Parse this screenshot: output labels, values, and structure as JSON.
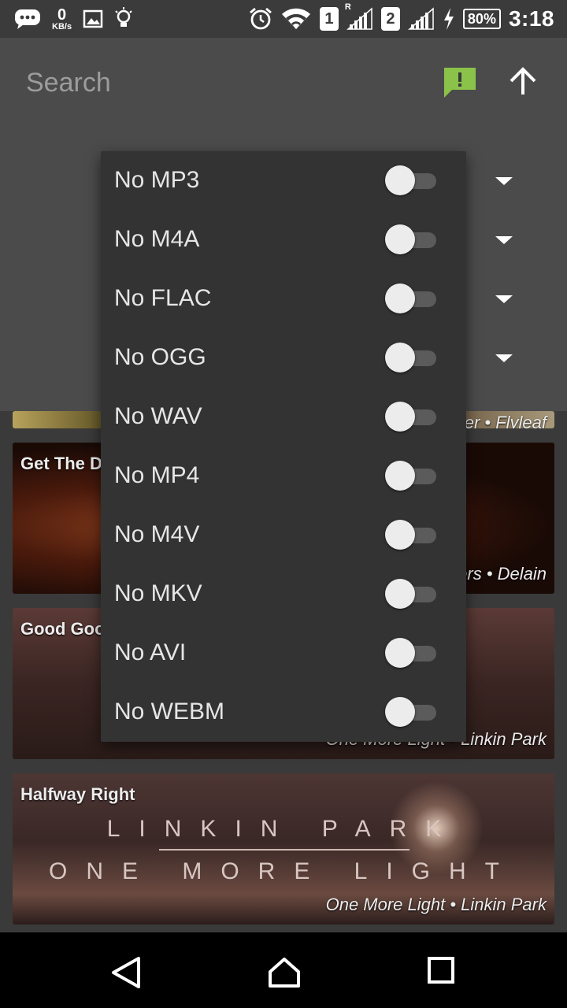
{
  "status_bar": {
    "net_speed_value": "0",
    "net_speed_unit": "KB/s",
    "sim1": "1",
    "sim1_roaming": "R",
    "sim2": "2",
    "battery": "80%",
    "time": "3:18"
  },
  "header": {
    "search_placeholder": "Search"
  },
  "menu": {
    "items": [
      {
        "label": "No MP3",
        "checked": false
      },
      {
        "label": "No M4A",
        "checked": false
      },
      {
        "label": "No FLAC",
        "checked": false
      },
      {
        "label": "No OGG",
        "checked": false
      },
      {
        "label": "No WAV",
        "checked": false
      },
      {
        "label": "No MP4",
        "checked": false
      },
      {
        "label": "No M4V",
        "checked": false
      },
      {
        "label": "No MKV",
        "checked": false
      },
      {
        "label": "No AVI",
        "checked": false
      },
      {
        "label": "No WEBM",
        "checked": false
      }
    ]
  },
  "cards": [
    {
      "title": "",
      "meta": "er • Flyleaf"
    },
    {
      "title": "Get The D",
      "meta": "ers • Delain"
    },
    {
      "title": "Good Goo",
      "meta": "One More Light • Linkin Park"
    },
    {
      "title": "Halfway Right",
      "meta": "One More Light • Linkin Park",
      "art_line1": "LINKIN PARK",
      "art_line2": "ONE MORE LIGHT"
    }
  ],
  "colors": {
    "accent": "#8bc34a",
    "header_bg": "#4b4b4b",
    "popup_bg": "#333333",
    "switch_thumb": "#ececec",
    "switch_track": "#5b5b5b"
  }
}
